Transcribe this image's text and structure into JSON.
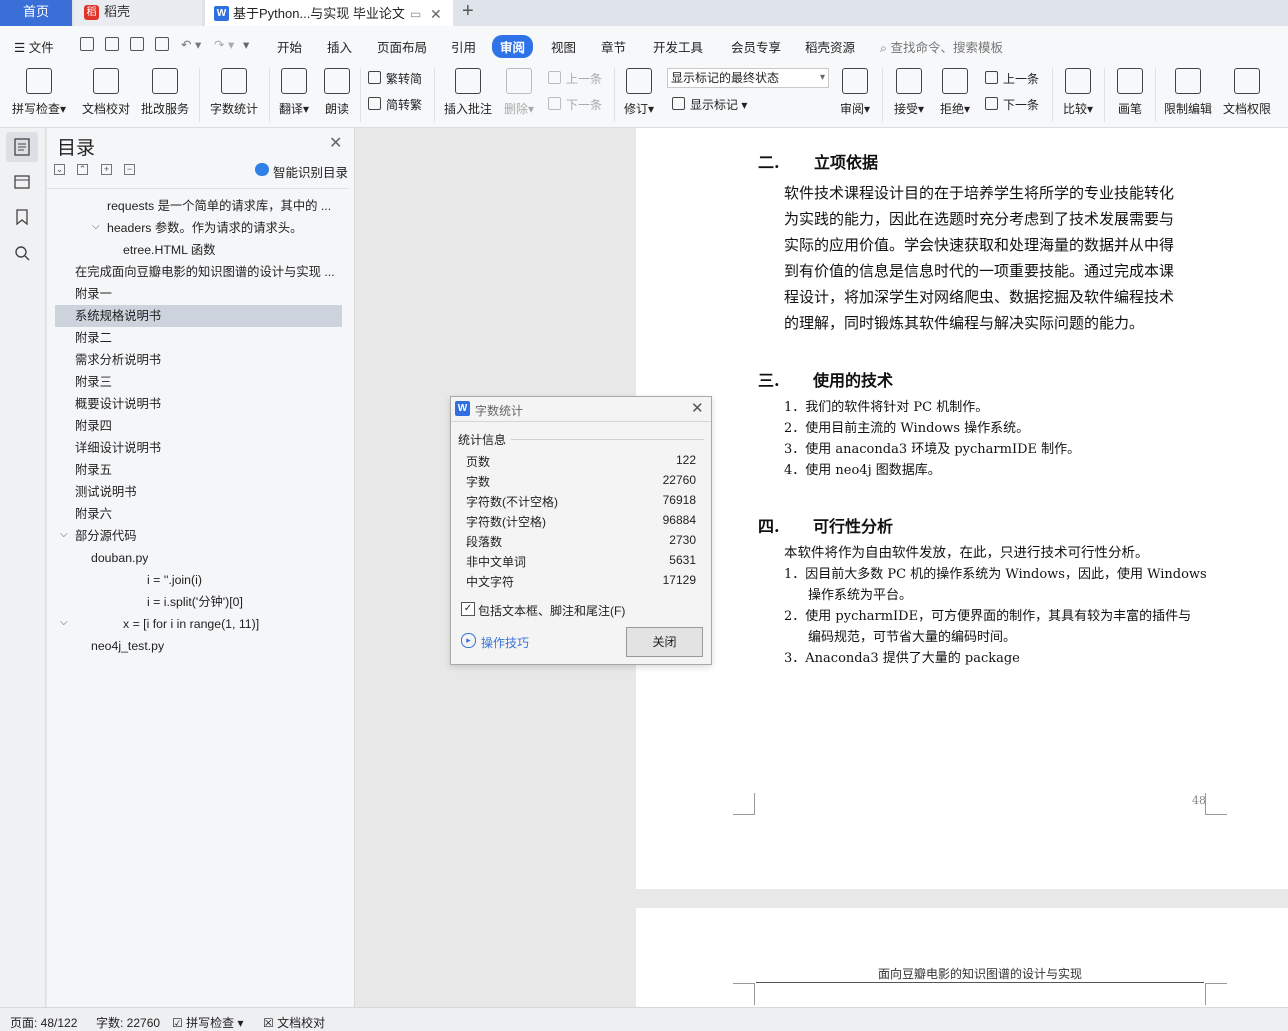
{
  "tabs": {
    "home": "首页",
    "daoke": "稻壳",
    "doc": "基于Python...与实现 毕业论文",
    "add": "+"
  },
  "menu": {
    "file": "文件",
    "items": [
      "开始",
      "插入",
      "页面布局",
      "引用",
      "审阅",
      "视图",
      "章节",
      "开发工具",
      "会员专享",
      "稻壳资源"
    ],
    "active": "审阅",
    "search_placeholder": "查找命令、搜索模板"
  },
  "ribbon": {
    "spellcheck": "拼写检查",
    "doc_proof": "文档校对",
    "correction_service": "批改服务",
    "word_count": "字数统计",
    "translate": "翻译",
    "read_aloud": "朗读",
    "trad_to_simp": "繁转简",
    "simp_to_trad": "简转繁",
    "insert_comment": "插入批注",
    "delete": "删除",
    "prev_comment": "上一条",
    "next_comment": "下一条",
    "revise": "修订",
    "markup_state": "显示标记的最终状态",
    "show_markup": "显示标记",
    "review": "审阅",
    "accept": "接受",
    "reject": "拒绝",
    "prev_change": "上一条",
    "next_change": "下一条",
    "compare": "比较",
    "pen": "画笔",
    "restrict_edit": "限制编辑",
    "doc_permission": "文档权限"
  },
  "nav": {
    "title": "目录",
    "smart_toc": "智能识别目录",
    "items": [
      "requests 是一个简单的请求库，其中的 ...",
      "headers 参数。作为请求的请求头。",
      "etree.HTML 函数",
      "在完成面向豆瓣电影的知识图谱的设计与实现 ...",
      "附录一",
      "系统规格说明书",
      "附录二",
      "需求分析说明书",
      "附录三",
      "概要设计说明书",
      "附录四",
      "详细设计说明书",
      "附录五",
      "测试说明书",
      "附录六",
      "部分源代码",
      "douban.py",
      "i = ''.join(i)",
      "i = i.split('分钟')[0]",
      "x = [i for i in range(1, 11)]",
      "neo4j_test.py"
    ]
  },
  "dialog": {
    "title": "字数统计",
    "section": "统计信息",
    "stats": [
      {
        "label": "页数",
        "value": "122"
      },
      {
        "label": "字数",
        "value": "22760"
      },
      {
        "label": "字符数(不计空格)",
        "value": "76918"
      },
      {
        "label": "字符数(计空格)",
        "value": "96884"
      },
      {
        "label": "段落数",
        "value": "2730"
      },
      {
        "label": "非中文单词",
        "value": "5631"
      },
      {
        "label": "中文字符",
        "value": "17129"
      }
    ],
    "include_checkbox": "包括文本框、脚注和尾注(F)",
    "tips": "操作技巧",
    "close": "关闭"
  },
  "document": {
    "h2_num": "二.",
    "h2_title": "立项依据",
    "p1_lines": [
      "软件技术课程设计目的在于培养学生将所学的专业技能转化",
      "为实践的能力，因此在选题时充分考虑到了技术发展需要与",
      "实际的应用价值。学会快速获取和处理海量的数据并从中得",
      "到有价值的信息是信息时代的一项重要技能。通过完成本课",
      "程设计，将加深学生对网络爬虫、数据挖掘及软件编程技术",
      "的理解，同时锻炼其软件编程与解决实际问题的能力。"
    ],
    "h3_num": "三.",
    "h3_title": "使用的技术",
    "tech": [
      "1．我们的软件将针对 PC 机制作。",
      "2．使用目前主流的 Windows 操作系统。",
      "3．使用 anaconda3 环境及 pycharmIDE 制作。",
      "4．使用 neo4j 图数据库。"
    ],
    "h4_num": "四.",
    "h4_title": "可行性分析",
    "feas_intro": "本软件将作为自由软件发放，在此，只进行技术可行性分析。",
    "feas_lines": [
      "1．因目前大多数 PC 机的操作系统为 Windows，因此，使用 Windows",
      "操作系统为平台。",
      "2．使用 pycharmIDE，可方便界面的制作，其具有较为丰富的插件与",
      "编码规范，可节省大量的编码时间。",
      "3．Anaconda3 提供了大量的 package"
    ],
    "page_num": "48",
    "next_header": "面向豆瓣电影的知识图谱的设计与实现"
  },
  "status": {
    "page": "页面: 48/122",
    "words": "字数: 22760",
    "spellcheck": "拼写检查",
    "proof": "文档校对"
  }
}
